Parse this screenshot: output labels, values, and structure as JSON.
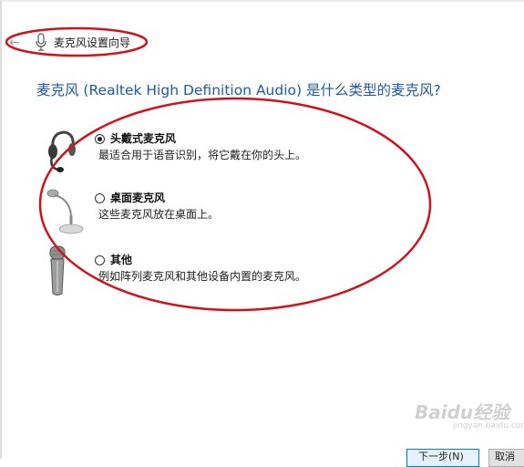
{
  "header": {
    "window_title": "麦克风设置向导",
    "back_glyph": "←"
  },
  "question": "麦克风 (Realtek High Definition Audio) 是什么类型的麦克风?",
  "options": [
    {
      "label": "头戴式麦克风",
      "description": "最适合用于语音识别，将它戴在你的头上。",
      "checked": true,
      "icon": "headset-microphone-icon"
    },
    {
      "label": "桌面麦克风",
      "description": "这些麦克风放在桌面上。",
      "checked": false,
      "icon": "desktop-microphone-icon"
    },
    {
      "label": "其他",
      "description": "例如阵列麦克风和其他设备内置的麦克风。",
      "checked": false,
      "icon": "handheld-microphone-icon"
    }
  ],
  "buttons": {
    "next_label": "下一步(N)",
    "cancel_label": "取消"
  },
  "watermark": {
    "brand": "Baidu经验",
    "sub": "jingyan.baidu.com"
  },
  "colors": {
    "question_text": "#1e5aa8",
    "annotation_red": "#d0121b",
    "primary_button_border": "#0078d7"
  }
}
